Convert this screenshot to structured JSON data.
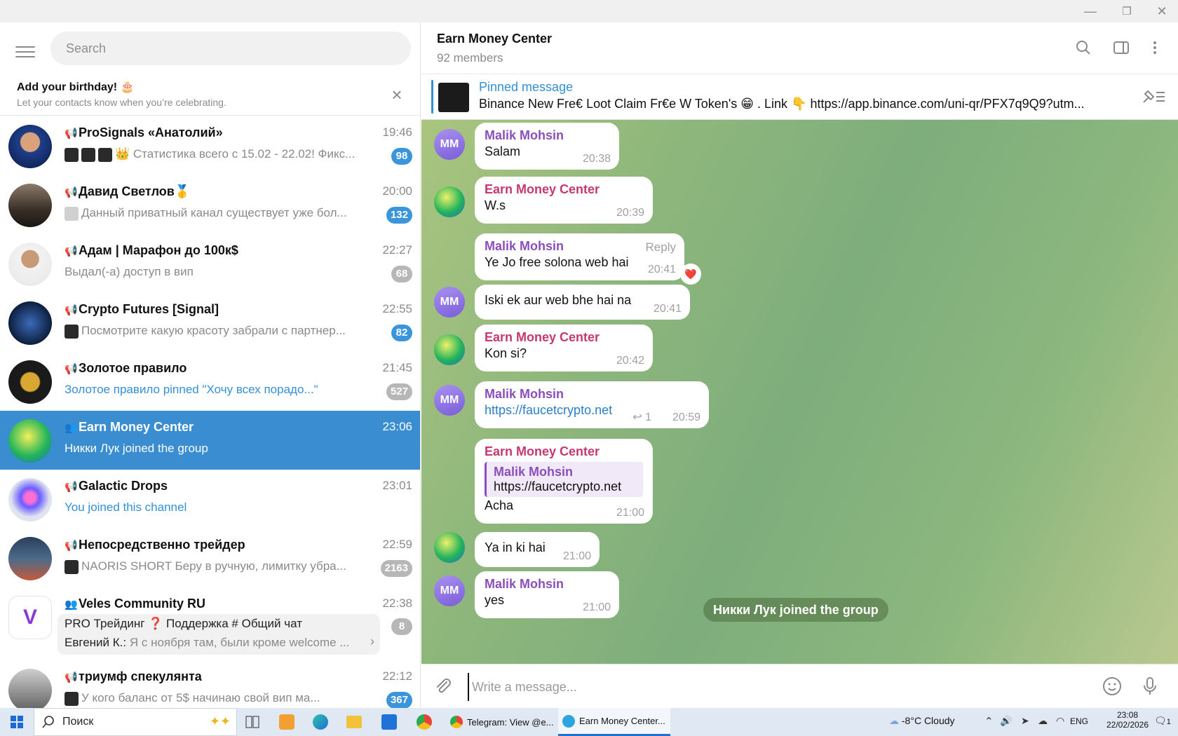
{
  "window": {
    "minimize": "—",
    "maximize": "❐",
    "close": "✕"
  },
  "search": {
    "placeholder": "Search"
  },
  "birthday": {
    "title": "Add your birthday! 🎂",
    "subtitle": "Let your contacts know when you’re celebrating."
  },
  "chats": [
    {
      "name": "ProSignals «Анатолий»",
      "time": "19:46",
      "preview": "👑 Статистика всего с 15.02 - 22.02!  Фикс...",
      "badge": "98",
      "badge_muted": false,
      "kind": "channel",
      "preview_style": "normal"
    },
    {
      "name": "Давид Светлов🥇",
      "time": "20:00",
      "preview": "Данный приватный канал существует уже бол...",
      "badge": "132",
      "badge_muted": false,
      "kind": "channel",
      "preview_style": "normal"
    },
    {
      "name": "Адам | Марафон до 100к$",
      "time": "22:27",
      "preview": "Выдал(-а) доступ в вип",
      "badge": "68",
      "badge_muted": true,
      "kind": "channel",
      "preview_style": "normal"
    },
    {
      "name": "Crypto Futures [Signal]",
      "time": "22:55",
      "preview": "Посмотрите какую красоту забрали с партнер...",
      "badge": "82",
      "badge_muted": false,
      "kind": "channel",
      "preview_style": "normal"
    },
    {
      "name": "Золотое правило",
      "time": "21:45",
      "preview": "Золотое правило pinned \"Хочу всех порадо...\"",
      "badge": "527",
      "badge_muted": true,
      "kind": "channel",
      "preview_style": "blue"
    },
    {
      "name": "Earn Money Center",
      "time": "23:06",
      "preview": "Никки Лук joined the group",
      "badge": "",
      "badge_muted": false,
      "kind": "group",
      "preview_style": "normal",
      "active": true
    },
    {
      "name": "Galactic Drops",
      "time": "23:01",
      "preview": "You joined this channel",
      "badge": "",
      "badge_muted": false,
      "kind": "channel",
      "preview_style": "blue"
    },
    {
      "name": "Непосредственно трейдер",
      "time": "22:59",
      "preview": "NAORIS SHORT  Беру в ручную, лимитку убра...",
      "badge": "2163",
      "badge_muted": true,
      "kind": "channel",
      "preview_style": "normal"
    },
    {
      "name": "Veles Community RU",
      "time": "22:38",
      "topics": "PRO Трейдинг   ❓ Поддержка   # Общий чат",
      "preview_sender": "Евгений К.:",
      "preview": "Я с ноября там, были кроме welcome ...",
      "badge": "8",
      "badge_muted": true,
      "kind": "group",
      "preview_style": "normal"
    },
    {
      "name": "триумф спекулянта",
      "time": "22:12",
      "preview": "У кого баланс от 5$  начинаю свой вип ма...",
      "badge": "367",
      "badge_muted": false,
      "kind": "channel",
      "preview_style": "normal"
    }
  ],
  "header": {
    "title": "Earn Money Center",
    "subtitle": "92 members"
  },
  "pinned": {
    "title": "Pinned message",
    "text": "Binance New Fre€ Loot Claim Fr€e W Token's 😁 .  Link 👇 https://app.binance.com/uni-qr/PFX7q9Q9?utm..."
  },
  "messages": [
    {
      "sender": "Malik Mohsin",
      "text": "Salam",
      "time": "20:38"
    },
    {
      "sender": "Earn Money Center",
      "text": "W.s",
      "time": "20:39"
    },
    {
      "sender": "Malik Mohsin",
      "text": "Ye Jo free solona web hai",
      "time": "20:41",
      "reply_label": "Reply",
      "reaction": "❤️"
    },
    {
      "sender": "",
      "text": "Iski ek aur web bhe hai na",
      "time": "20:41"
    },
    {
      "sender": "Earn Money Center",
      "text": "Kon si?",
      "time": "20:42"
    },
    {
      "sender": "Malik Mohsin",
      "text": "https://faucetcrypto.net",
      "time": "20:59",
      "replies": "1"
    },
    {
      "sender": "Earn Money Center",
      "quote_sender": "Malik Mohsin",
      "quote_text": "https://faucetcrypto.net",
      "text": "Acha",
      "time": "21:00"
    },
    {
      "sender": "",
      "text": "Ya in ki hai",
      "time": "21:00"
    },
    {
      "sender": "Malik Mohsin",
      "text": "yes",
      "time": "21:00"
    }
  ],
  "avatar_initials": "MM",
  "service_message": "Никки Лук joined the group",
  "composer": {
    "placeholder": "Write a message..."
  },
  "taskbar": {
    "search_label": "Поиск",
    "apps": [
      {
        "label": "Telegram: View @e..."
      },
      {
        "label": "Earn Money Center..."
      }
    ],
    "weather": "-8°C  Cloudy",
    "lang": "ENG",
    "time": "23:08",
    "date": "22/02/2026",
    "notification_count": "1"
  }
}
